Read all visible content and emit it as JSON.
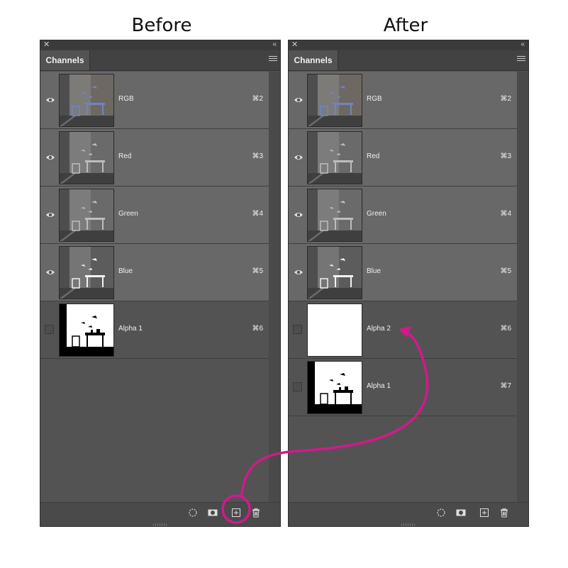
{
  "headings": {
    "before": "Before",
    "after": "After"
  },
  "before": {
    "tab_label": "Channels",
    "channels": [
      {
        "name": "RGB",
        "shortcut": "⌘2",
        "visible": true,
        "thumb": "rgb-scene"
      },
      {
        "name": "Red",
        "shortcut": "⌘3",
        "visible": true,
        "thumb": "gray-scene"
      },
      {
        "name": "Green",
        "shortcut": "⌘4",
        "visible": true,
        "thumb": "gray-scene"
      },
      {
        "name": "Blue",
        "shortcut": "⌘5",
        "visible": true,
        "thumb": "blue-scene"
      },
      {
        "name": "Alpha 1",
        "shortcut": "⌘6",
        "visible": false,
        "thumb": "mask-silhouette"
      }
    ]
  },
  "after": {
    "tab_label": "Channels",
    "channels": [
      {
        "name": "RGB",
        "shortcut": "⌘2",
        "visible": true,
        "thumb": "rgb-scene"
      },
      {
        "name": "Red",
        "shortcut": "⌘3",
        "visible": true,
        "thumb": "gray-scene"
      },
      {
        "name": "Green",
        "shortcut": "⌘4",
        "visible": true,
        "thumb": "gray-scene"
      },
      {
        "name": "Blue",
        "shortcut": "⌘5",
        "visible": true,
        "thumb": "blue-scene"
      },
      {
        "name": "Alpha 2",
        "shortcut": "⌘6",
        "visible": false,
        "thumb": "blank-white"
      },
      {
        "name": "Alpha 1",
        "shortcut": "⌘7",
        "visible": false,
        "thumb": "mask-silhouette"
      }
    ]
  },
  "footer_icons": [
    "load-selection-icon",
    "save-selection-icon",
    "new-channel-icon",
    "delete-channel-icon"
  ],
  "colors": {
    "annotation": "#d11a8c",
    "panel": "#535353",
    "visible_row": "#686868"
  }
}
